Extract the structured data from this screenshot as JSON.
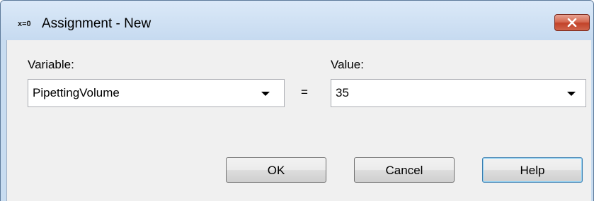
{
  "window": {
    "icon_text": "x=0",
    "title": "Assignment - New",
    "close_glyph": "close-icon"
  },
  "form": {
    "variable_label": "Variable:",
    "variable_value": "PipettingVolume",
    "equals": "=",
    "value_label": "Value:",
    "value_value": "35"
  },
  "buttons": {
    "ok": "OK",
    "cancel": "Cancel",
    "help": "Help"
  },
  "colors": {
    "titlebar": "#c6daf0",
    "close_button": "#c2432a",
    "client_bg": "#f0f0f0",
    "default_button_border": "#3c7fb1"
  }
}
